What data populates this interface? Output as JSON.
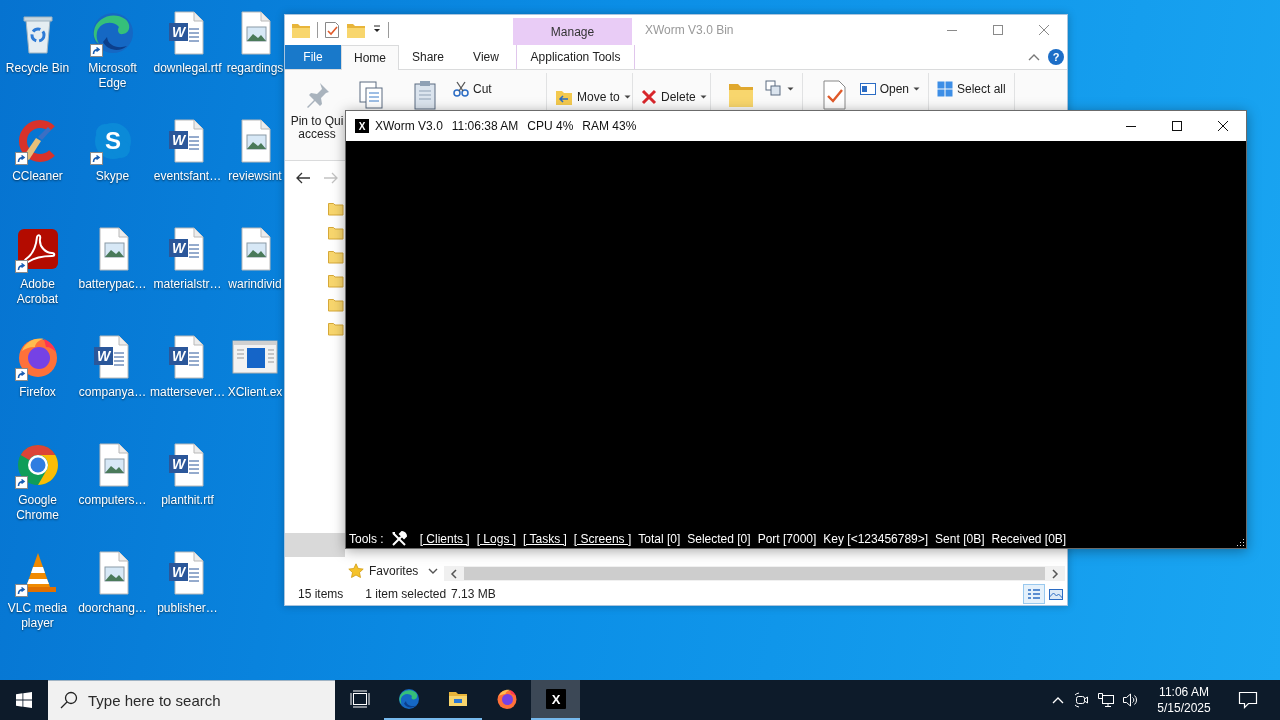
{
  "desktop": {
    "icons": [
      {
        "label": "Recycle Bin",
        "kind": "recycle-bin",
        "shortcut": false
      },
      {
        "label": "CCleaner",
        "kind": "ccleaner",
        "shortcut": true
      },
      {
        "label": "Adobe Acrobat",
        "kind": "acrobat",
        "shortcut": true
      },
      {
        "label": "Firefox",
        "kind": "firefox",
        "shortcut": true
      },
      {
        "label": "Google Chrome",
        "kind": "chrome",
        "shortcut": true
      },
      {
        "label": "VLC media player",
        "kind": "vlc",
        "shortcut": true
      },
      {
        "label": "Microsoft Edge",
        "kind": "edge",
        "shortcut": true
      },
      {
        "label": "Skype",
        "kind": "skype",
        "shortcut": true,
        "glyph": "S"
      },
      {
        "label": "batterypac…",
        "kind": "image-file",
        "shortcut": false
      },
      {
        "label": "companya…",
        "kind": "word-file",
        "shortcut": false,
        "glyph": "W"
      },
      {
        "label": "computers…",
        "kind": "image-file",
        "shortcut": false
      },
      {
        "label": "doorchang…",
        "kind": "image-file",
        "shortcut": false
      },
      {
        "label": "downlegal.rtf",
        "kind": "word-file",
        "shortcut": false,
        "glyph": "W"
      },
      {
        "label": "eventsfant…",
        "kind": "word-file",
        "shortcut": false,
        "glyph": "W"
      },
      {
        "label": "materialstr…",
        "kind": "word-file",
        "shortcut": false,
        "glyph": "W"
      },
      {
        "label": "mattersever…",
        "kind": "word-file",
        "shortcut": false,
        "glyph": "W"
      },
      {
        "label": "planthit.rtf",
        "kind": "word-file",
        "shortcut": false,
        "glyph": "W"
      },
      {
        "label": "publisher…",
        "kind": "word-file",
        "shortcut": false,
        "glyph": "W"
      },
      {
        "label": "regardings",
        "kind": "image-file",
        "shortcut": false
      },
      {
        "label": "reviewsint",
        "kind": "image-file",
        "shortcut": false
      },
      {
        "label": "warindivid",
        "kind": "image-file",
        "shortcut": false
      },
      {
        "label": "XClient.ex",
        "kind": "program",
        "shortcut": false
      }
    ]
  },
  "explorer": {
    "title": "XWorm V3.0 Bin",
    "context_group": "Manage",
    "help_glyph": "?",
    "tabs": [
      {
        "label": "File",
        "kind": "file",
        "selected": false
      },
      {
        "label": "Home",
        "kind": "main",
        "selected": true
      },
      {
        "label": "Share",
        "kind": "main",
        "selected": false
      },
      {
        "label": "View",
        "kind": "main",
        "selected": false
      },
      {
        "label": "Application Tools",
        "kind": "context",
        "selected": false
      }
    ],
    "ribbon": [
      {
        "commands": [
          {
            "kind": "pin",
            "label": "Pin to Qui\naccess"
          },
          {
            "kind": "copy"
          },
          {
            "kind": "paste"
          },
          {
            "stack": [
              {
                "kind": "cut",
                "label": "Cut"
              }
            ]
          }
        ]
      },
      {
        "commands": [
          {
            "stack": [
              {
                "kind": "move-to",
                "label": "Move to",
                "dropdown": true
              }
            ]
          }
        ]
      },
      {
        "commands": [
          {
            "stack": [
              {
                "kind": "delete",
                "label": "Delete",
                "dropdown": true
              }
            ]
          }
        ]
      },
      {
        "commands": [
          {
            "kind": "new-folder"
          },
          {
            "stack": [
              {
                "kind": "new-item",
                "dropdown": true
              }
            ]
          }
        ]
      },
      {
        "commands": [
          {
            "kind": "properties"
          },
          {
            "stack": [
              {
                "kind": "open",
                "label": "Open",
                "dropdown": true
              }
            ]
          }
        ]
      },
      {
        "commands": [
          {
            "stack": [
              {
                "kind": "select-all",
                "label": "Select all"
              }
            ]
          }
        ]
      }
    ],
    "nav_buttons": [
      {
        "kind": "back",
        "disabled": false
      },
      {
        "kind": "forward",
        "disabled": true
      }
    ],
    "navigation_pane": {
      "items": [
        {
          "kind": "folder",
          "selected": false
        },
        {
          "kind": "folder",
          "selected": false
        },
        {
          "kind": "folder",
          "selected": false
        },
        {
          "kind": "folder",
          "selected": false
        },
        {
          "kind": "folder",
          "selected": false
        },
        {
          "kind": "folder",
          "selected": false
        },
        {
          "kind": "blank",
          "selected": true
        }
      ],
      "favorites": "Favorites"
    },
    "status_bar": {
      "item_count": "15 items",
      "selection": "1 item selected",
      "size": "7.13 MB",
      "views": [
        {
          "kind": "details",
          "selected": true
        },
        {
          "kind": "large-icons",
          "selected": false
        }
      ]
    }
  },
  "xworm": {
    "title_glyph": "X",
    "title": "XWorm V3.0",
    "time": "11:06:38 AM",
    "cpu": "CPU 4%",
    "ram": "RAM 43%",
    "tools_label": "Tools :",
    "links": [
      "[ Clients ]",
      "[ Logs ]",
      "[ Tasks ]",
      "[ Screens ]"
    ],
    "stats": [
      "Total [0]",
      "Selected [0]",
      "Port [7000]",
      "Key [<123456789>]",
      "Sent [0B]",
      "Received [0B]"
    ]
  },
  "taskbar": {
    "search_placeholder": "Type here to search",
    "apps": [
      {
        "kind": "task-view",
        "running": false,
        "selected": false
      },
      {
        "kind": "edge",
        "running": true,
        "selected": false
      },
      {
        "kind": "explorer",
        "running": true,
        "selected": false
      },
      {
        "kind": "firefox",
        "running": false,
        "selected": false
      },
      {
        "kind": "xworm",
        "running": true,
        "selected": true,
        "glyph": "X"
      }
    ],
    "tray": {
      "icons": [
        {
          "kind": "chevron"
        },
        {
          "kind": "camera"
        },
        {
          "kind": "network"
        },
        {
          "kind": "volume"
        }
      ],
      "time": "11:06 AM",
      "date": "5/15/2025"
    }
  }
}
